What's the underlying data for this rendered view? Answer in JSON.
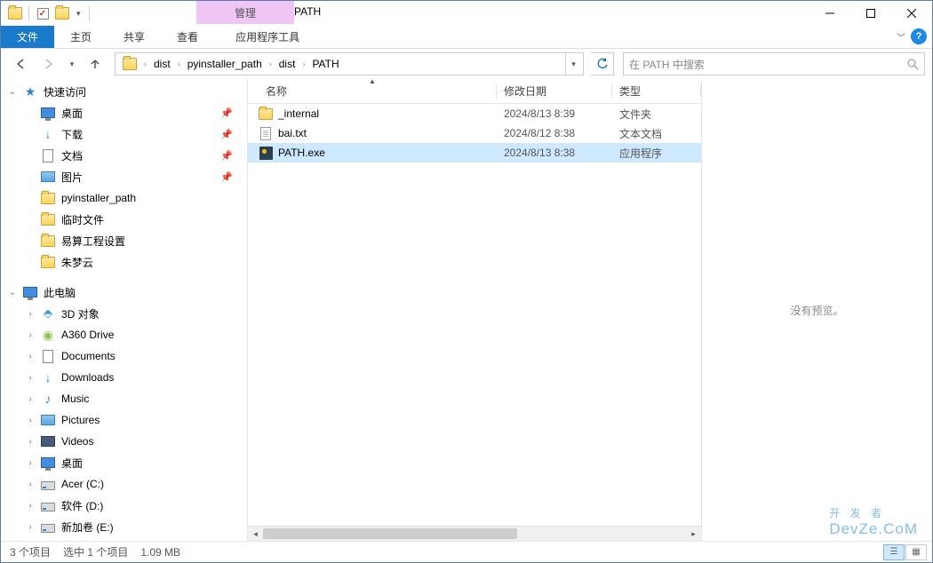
{
  "window": {
    "title": "PATH",
    "context_tab_group": "管理"
  },
  "ribbon": {
    "file": "文件",
    "home": "主页",
    "share": "共享",
    "view": "查看",
    "context": "应用程序工具"
  },
  "nav": {
    "back_tip": "返回",
    "forward_tip": "前进",
    "up_tip": "上移"
  },
  "breadcrumb": [
    "dist",
    "pyinstaller_path",
    "dist",
    "PATH"
  ],
  "search": {
    "placeholder": "在 PATH 中搜索"
  },
  "navpane": {
    "quick_access": "快速访问",
    "quick_items": [
      {
        "label": "桌面",
        "icon": "monitor",
        "pinned": true
      },
      {
        "label": "下载",
        "icon": "download",
        "pinned": true
      },
      {
        "label": "文档",
        "icon": "doc",
        "pinned": true
      },
      {
        "label": "图片",
        "icon": "pic",
        "pinned": true
      },
      {
        "label": "pyinstaller_path",
        "icon": "folder",
        "pinned": false
      },
      {
        "label": "临时文件",
        "icon": "folder",
        "pinned": false
      },
      {
        "label": "易算工程设置",
        "icon": "folder",
        "pinned": false
      },
      {
        "label": "朱梦云",
        "icon": "folder",
        "pinned": false
      }
    ],
    "this_pc": "此电脑",
    "pc_items": [
      {
        "label": "3D 对象",
        "icon": "cube"
      },
      {
        "label": "A360 Drive",
        "icon": "cloud"
      },
      {
        "label": "Documents",
        "icon": "doc"
      },
      {
        "label": "Downloads",
        "icon": "download"
      },
      {
        "label": "Music",
        "icon": "music"
      },
      {
        "label": "Pictures",
        "icon": "pic"
      },
      {
        "label": "Videos",
        "icon": "vid"
      },
      {
        "label": "桌面",
        "icon": "monitor"
      },
      {
        "label": "Acer (C:)",
        "icon": "drive"
      },
      {
        "label": "软件 (D:)",
        "icon": "drive"
      },
      {
        "label": "新加卷 (E:)",
        "icon": "drive"
      }
    ]
  },
  "columns": {
    "name": "名称",
    "date": "修改日期",
    "type": "类型"
  },
  "files": [
    {
      "name": "_internal",
      "date": "2024/8/13 8:39",
      "type": "文件夹",
      "icon": "folder",
      "selected": false
    },
    {
      "name": "bai.txt",
      "date": "2024/8/12 8:38",
      "type": "文本文档",
      "icon": "txt",
      "selected": false
    },
    {
      "name": "PATH.exe",
      "date": "2024/8/13 8:38",
      "type": "应用程序",
      "icon": "exe",
      "selected": true
    }
  ],
  "preview": {
    "empty": "没有预览。"
  },
  "status": {
    "count": "3 个项目",
    "selection": "选中 1 个项目",
    "size": "1.09 MB"
  },
  "watermark": {
    "line1": "开 发 者",
    "line2": "DevZe.CoM"
  }
}
